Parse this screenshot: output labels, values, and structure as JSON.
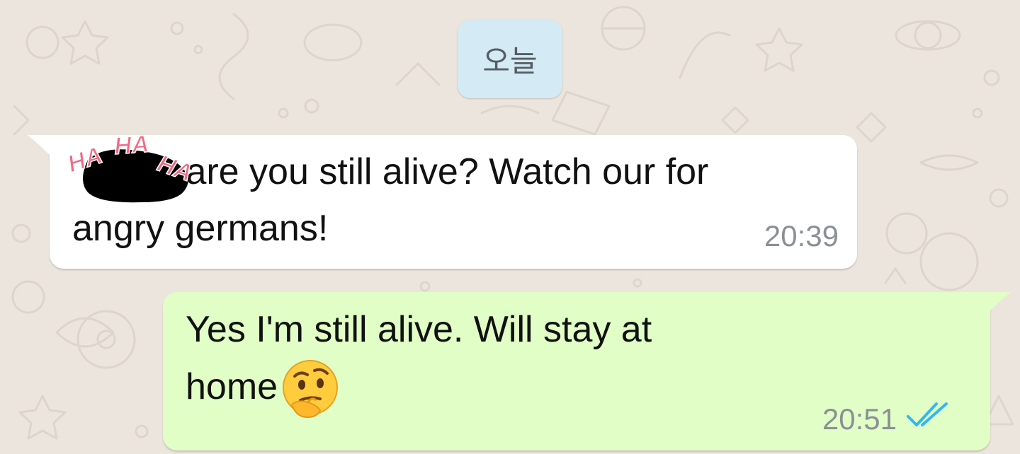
{
  "date_chip": {
    "label": "오늘"
  },
  "messages": [
    {
      "direction": "incoming",
      "text_line1": " are you still alive? Watch our for",
      "text_line2": "angry germans!",
      "time": "20:39",
      "sticker": "haha-sticker-redaction"
    },
    {
      "direction": "outgoing",
      "text_line1": "Yes I'm still alive. Will stay at",
      "text_line2": "home",
      "emoji": "thinking-face",
      "time": "20:51",
      "status": "read-double-check"
    }
  ],
  "colors": {
    "background": "#ece5dd",
    "incoming_bubble": "#ffffff",
    "outgoing_bubble": "#e1fec6",
    "date_chip": "#d4eaf4",
    "read_ticks": "#34b7f1",
    "haha_text": "#f06a86"
  }
}
